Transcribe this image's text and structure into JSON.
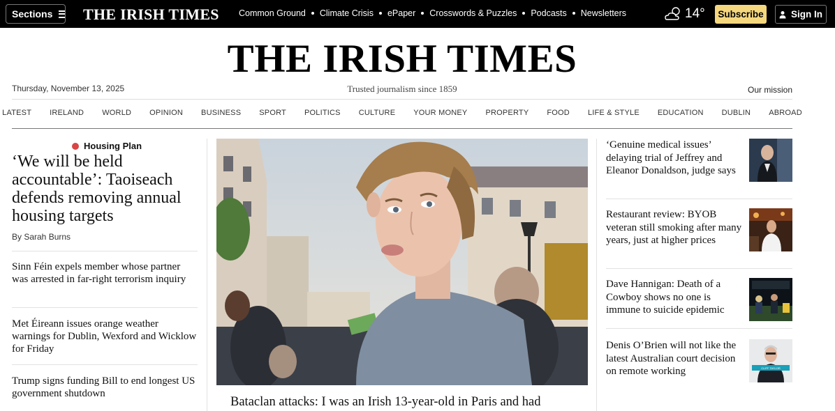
{
  "topbar": {
    "sections_label": "Sections",
    "logo": "THE IRISH TIMES",
    "links": [
      "Common Ground",
      "Climate Crisis",
      "ePaper",
      "Crosswords & Puzzles",
      "Podcasts",
      "Newsletters"
    ],
    "weather_temp": "14°",
    "weather_icon": "partly-cloudy-icon",
    "subscribe_label": "Subscribe",
    "signin_label": "Sign In"
  },
  "masthead": {
    "title": "THE IRISH TIMES",
    "date": "Thursday, November 13, 2025",
    "tagline": "Trusted journalism since 1859",
    "mission_link": "Our mission"
  },
  "nav": {
    "items": [
      "LATEST",
      "IRELAND",
      "WORLD",
      "OPINION",
      "BUSINESS",
      "SPORT",
      "POLITICS",
      "CULTURE",
      "YOUR MONEY",
      "PROPERTY",
      "FOOD",
      "LIFE & STYLE",
      "EDUCATION",
      "DUBLIN",
      "ABROAD"
    ]
  },
  "left": {
    "kicker": "Housing Plan",
    "lead_headline": "‘We will be held accountable’: Taoiseach defends removing annual housing targets",
    "byline": "By Sarah Burns",
    "stories": [
      "Sinn Féin expels member whose partner was arrested in far-right terrorism inquiry",
      "Met Éireann issues orange weather warnings for Dublin, Wexford and Wicklow for Friday",
      "Trump signs funding Bill to end longest US government shutdown"
    ]
  },
  "center": {
    "hero_headline": "Bataclan attacks: I was an Irish 13-year-old in Paris and had"
  },
  "right": {
    "stories": [
      "‘Genuine medical issues’ delaying trial of Jeffrey and Eleanor Donaldson, judge says",
      "Restaurant review: BYOB veteran still smoking after many years, just at higher prices",
      "Dave Hannigan: Death of a Cowboy shows no one is immune to suicide epidemic",
      "Denis O’Brien will not like the latest Australian court decision on remote working"
    ],
    "thumb4_caption": "CLIFF TAYLOR"
  },
  "colors": {
    "topbar_bg": "#000000",
    "subscribe_bg": "#f5d77e",
    "kicker_dot": "#d94545"
  }
}
